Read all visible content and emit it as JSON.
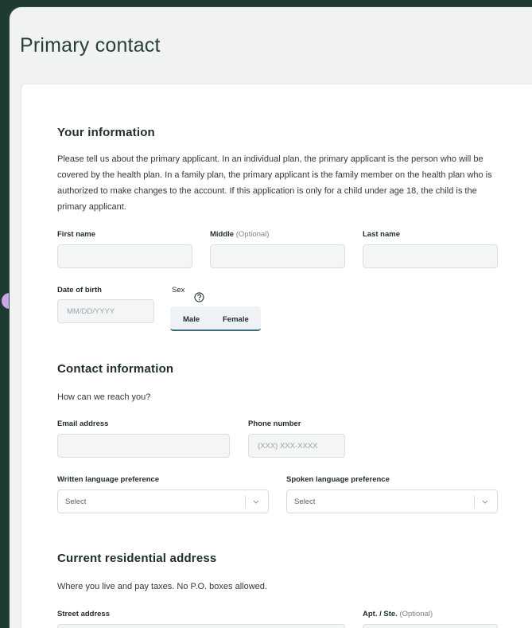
{
  "page": {
    "title": "Primary contact"
  },
  "your_information": {
    "heading": "Your information",
    "description": "Please tell us about the primary applicant. In an individual plan, the primary applicant is the person who will be covered by the health plan. In a family plan, the primary applicant is the family member on the health plan who is authorized to make changes to the account. If this application is only for a child under age 18, the child is the primary applicant.",
    "first_name_label": "First name",
    "middle_label": "Middle",
    "middle_optional": "(Optional)",
    "last_name_label": "Last name",
    "dob_label": "Date of birth",
    "dob_placeholder": "MM/DD/YYYY",
    "sex_label": "Sex",
    "sex_options": [
      "Male",
      "Female"
    ]
  },
  "contact_information": {
    "heading": "Contact information",
    "description": "How can we reach you?",
    "email_label": "Email address",
    "phone_label": "Phone number",
    "phone_placeholder": "(XXX) XXX-XXXX",
    "written_lang_label": "Written language preference",
    "written_lang_value": "Select",
    "spoken_lang_label": "Spoken language preference",
    "spoken_lang_value": "Select"
  },
  "residential_address": {
    "heading": "Current residential address",
    "description": "Where you live and pay taxes. No P.O. boxes allowed.",
    "street_label": "Street address",
    "apt_label": "Apt. / Ste.",
    "apt_optional": "(Optional)"
  },
  "colors": {
    "background": "#1f3a33",
    "accent": "#3c6b78",
    "indicator_dot": "#c9a6e6"
  }
}
